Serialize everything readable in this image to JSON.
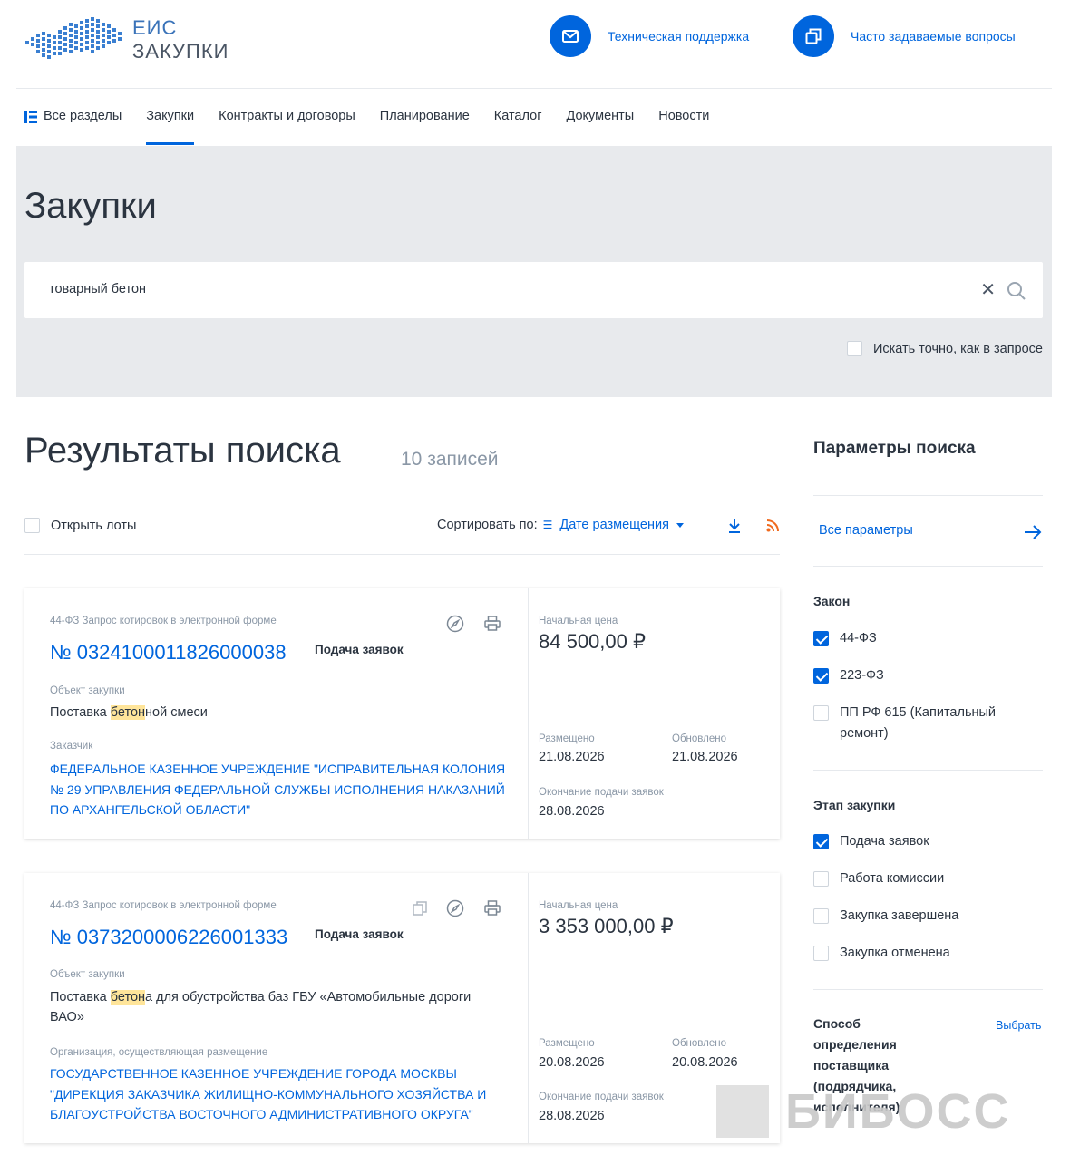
{
  "header": {
    "logo_line1": "ЕИС",
    "logo_line2": "ЗАКУПКИ",
    "support_label": "Техническая поддержка",
    "faq_label": "Часто задаваемые вопросы"
  },
  "nav": {
    "items": [
      "Все разделы",
      "Закупки",
      "Контракты и договоры",
      "Планирование",
      "Каталог",
      "Документы",
      "Новости"
    ],
    "active": "Закупки"
  },
  "page": {
    "title": "Закупки"
  },
  "search": {
    "value": "товарный бетон",
    "exact_label": "Искать точно, как в запросе"
  },
  "results": {
    "title": "Результаты поиска",
    "count": "10 записей",
    "open_lots_label": "Открыть лоты",
    "sort_label": "Сортировать по:",
    "sort_value": "Дате размещения",
    "cards": [
      {
        "type": "44-ФЗ Запрос котировок в электронной форме",
        "number": "№ 0324100011826000038",
        "stage": "Подача заявок",
        "object_label": "Объект закупки",
        "object_before": "Поставка ",
        "object_hl": "бетон",
        "object_after": "ной смеси",
        "customer_label": "Заказчик",
        "customer": "ФЕДЕРАЛЬНОЕ КАЗЕННОЕ УЧРЕЖДЕНИЕ \"ИСПРАВИТЕЛЬНАЯ КОЛОНИЯ № 29 УПРАВЛЕНИЯ ФЕДЕРАЛЬНОЙ СЛУЖБЫ ИСПОЛНЕНИЯ НАКАЗАНИЙ ПО АРХАНГЕЛЬСКОЙ ОБЛАСТИ\"",
        "price_label": "Начальная цена",
        "price": "84 500,00 ₽",
        "posted_label": "Размещено",
        "posted": "21.08.2026",
        "updated_label": "Обновлено",
        "updated": "21.08.2026",
        "deadline_label": "Окончание подачи заявок",
        "deadline": "28.08.2026"
      },
      {
        "type": "44-ФЗ Запрос котировок в электронной форме",
        "number": "№ 0373200006226001333",
        "stage": "Подача заявок",
        "object_label": "Объект закупки",
        "object_before": "Поставка ",
        "object_hl": "бетон",
        "object_after": "а для обустройства баз ГБУ «Автомобильные дороги ВАО»",
        "customer_label": "Организация, осуществляющая размещение",
        "customer": "ГОСУДАРСТВЕННОЕ КАЗЕННОЕ УЧРЕЖДЕНИЕ ГОРОДА МОСКВЫ \"ДИРЕКЦИЯ ЗАКАЗЧИКА ЖИЛИЩНО-КОММУНАЛЬНОГО ХОЗЯЙСТВА И БЛАГОУСТРОЙСТВА ВОСТОЧНОГО АДМИНИСТРАТИВНОГО ОКРУГА\"",
        "price_label": "Начальная цена",
        "price": "3 353 000,00 ₽",
        "posted_label": "Размещено",
        "posted": "20.08.2026",
        "updated_label": "Обновлено",
        "updated": "20.08.2026",
        "deadline_label": "Окончание подачи заявок",
        "deadline": "28.08.2026"
      }
    ]
  },
  "sidebar": {
    "title": "Параметры поиска",
    "all_params": "Все параметры",
    "law_title": "Закон",
    "laws": [
      {
        "label": "44-ФЗ",
        "checked": true
      },
      {
        "label": "223-ФЗ",
        "checked": true
      },
      {
        "label": "ПП РФ 615 (Капитальный ремонт)",
        "checked": false
      }
    ],
    "stage_title": "Этап закупки",
    "stages": [
      {
        "label": "Подача заявок",
        "checked": true
      },
      {
        "label": "Работа комиссии",
        "checked": false
      },
      {
        "label": "Закупка завершена",
        "checked": false
      },
      {
        "label": "Закупка отменена",
        "checked": false
      }
    ],
    "method_title": "Способ определения поставщика (подрядчика, исполнителя)",
    "choose_label": "Выбрать"
  },
  "watermark": "БИБОСС",
  "colors": {
    "accent": "#0065dd",
    "band": "#e8eaed",
    "highlight": "#ffe59a"
  },
  "icons": [
    "mail-icon",
    "copy-window-icon",
    "grid-icon",
    "close-icon",
    "search-icon",
    "sort-icon",
    "download-icon",
    "rss-icon",
    "compass-icon",
    "print-icon",
    "copy-icon",
    "arrow-right-icon"
  ]
}
